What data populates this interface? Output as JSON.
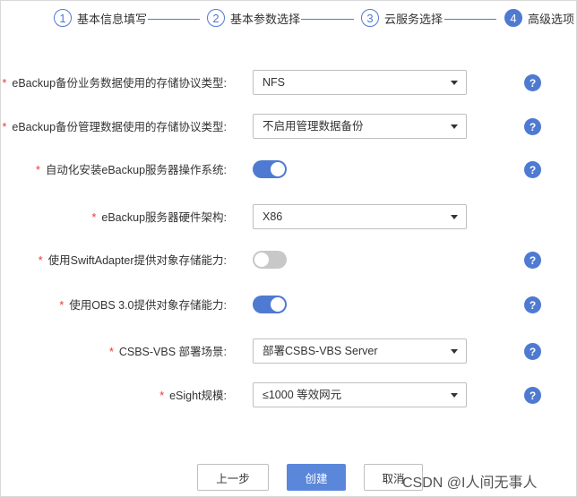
{
  "steps": [
    {
      "num": "1",
      "label": "基本信息填写",
      "active": false
    },
    {
      "num": "2",
      "label": "基本参数选择",
      "active": false
    },
    {
      "num": "3",
      "label": "云服务选择",
      "active": false
    },
    {
      "num": "4",
      "label": "高级选项",
      "active": true
    }
  ],
  "form": {
    "required_mark": "*",
    "help_symbol": "?",
    "rows": [
      {
        "label": "eBackup备份业务数据使用的存储协议类型:",
        "type": "select",
        "value": "NFS",
        "help": true
      },
      {
        "label": "eBackup备份管理数据使用的存储协议类型:",
        "type": "select",
        "value": "不启用管理数据备份",
        "help": true
      },
      {
        "label": "自动化安装eBackup服务器操作系统:",
        "type": "toggle",
        "value": "on",
        "help": true
      },
      {
        "label": "eBackup服务器硬件架构:",
        "type": "select",
        "value": "X86",
        "help": false
      },
      {
        "label": "使用SwiftAdapter提供对象存储能力:",
        "type": "toggle",
        "value": "off",
        "help": true
      },
      {
        "label": "使用OBS 3.0提供对象存储能力:",
        "type": "toggle",
        "value": "on",
        "help": true
      },
      {
        "label": "CSBS-VBS 部署场景:",
        "type": "select",
        "value": "部署CSBS-VBS Server",
        "help": true
      },
      {
        "label": "eSight规模:",
        "type": "select",
        "value": "≤1000 等效网元",
        "help": true
      }
    ]
  },
  "buttons": {
    "prev": "上一步",
    "create": "创建",
    "cancel": "取消"
  },
  "watermark": "CSDN @I人间无事人",
  "colors": {
    "accent": "#4f7ad1",
    "required": "#e53935",
    "toggle_off": "#c8c8c8"
  }
}
